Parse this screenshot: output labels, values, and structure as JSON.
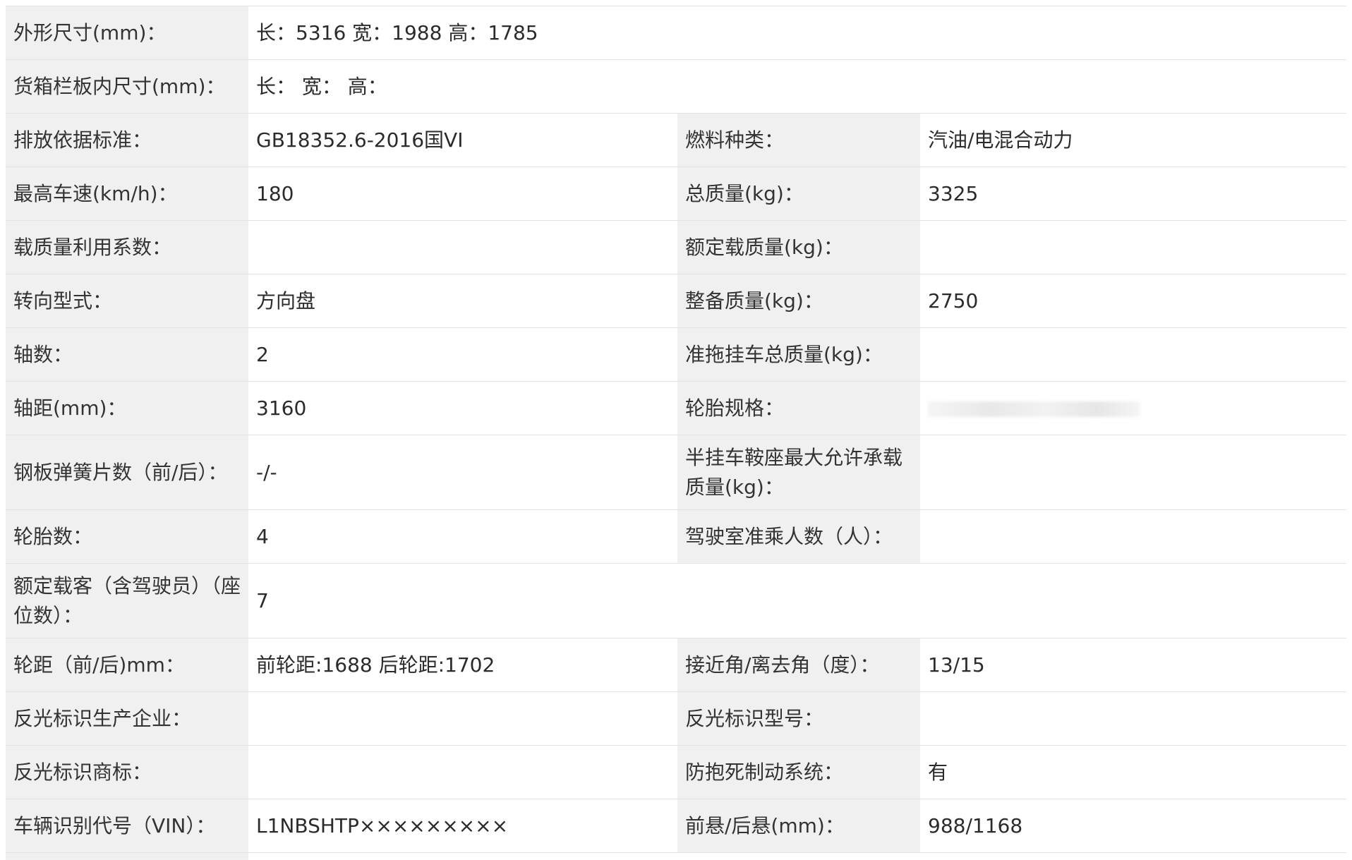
{
  "rows": {
    "r0": {
      "l1": "外形尺寸(mm)：",
      "v1": "长：5316 宽：1988 高：1785"
    },
    "r1": {
      "l1": "货箱栏板内尺寸(mm)：",
      "v1": "长： 宽： 高："
    },
    "r2": {
      "l1": "排放依据标准：",
      "v1": "GB18352.6-2016国VI",
      "l2": "燃料种类：",
      "v2": "汽油/电混合动力"
    },
    "r3": {
      "l1": "最高车速(km/h)：",
      "v1": "180",
      "l2": "总质量(kg)：",
      "v2": "3325"
    },
    "r4": {
      "l1": "载质量利用系数：",
      "v1": "",
      "l2": "额定载质量(kg)：",
      "v2": ""
    },
    "r5": {
      "l1": "转向型式：",
      "v1": "方向盘",
      "l2": "整备质量(kg)：",
      "v2": "2750"
    },
    "r6": {
      "l1": "轴数：",
      "v1": "2",
      "l2": "准拖挂车总质量(kg)：",
      "v2": ""
    },
    "r7": {
      "l1": "轴距(mm)：",
      "v1": "3160",
      "l2": "轮胎规格：",
      "v2": ""
    },
    "r8": {
      "l1": "钢板弹簧片数（前/后）：",
      "v1": "-/-",
      "l2": "半挂车鞍座最大允许承载质量(kg)：",
      "v2": ""
    },
    "r9": {
      "l1": "轮胎数：",
      "v1": "4",
      "l2": "驾驶室准乘人数（人）：",
      "v2": ""
    },
    "r10": {
      "l1": "额定载客（含驾驶员）（座位数）：",
      "v1": "7"
    },
    "r11": {
      "l1": "轮距（前/后)mm：",
      "v1": "前轮距:1688 后轮距:1702",
      "l2": "接近角/离去角（度）：",
      "v2": "13/15"
    },
    "r12": {
      "l1": "反光标识生产企业：",
      "v1": "",
      "l2": "反光标识型号：",
      "v2": ""
    },
    "r13": {
      "l1": "反光标识商标：",
      "v1": "",
      "l2": "防抱死制动系统：",
      "v2": "有"
    },
    "r14": {
      "l1": "车辆识别代号（VIN）：",
      "v1": "L1NBSHTP×××××××××",
      "l2": "前悬/后悬(mm)：",
      "v2": "988/1168"
    }
  }
}
